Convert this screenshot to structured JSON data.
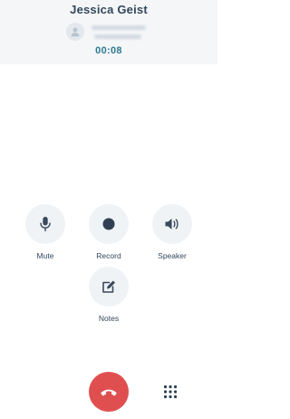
{
  "caller": {
    "name": "Jessica Geist",
    "timer": "00:08"
  },
  "controls": [
    {
      "key": "mute",
      "label": "Mute",
      "icon": "microphone-icon"
    },
    {
      "key": "record",
      "label": "Record",
      "icon": "record-dot-icon"
    },
    {
      "key": "speaker",
      "label": "Speaker",
      "icon": "speaker-icon"
    },
    {
      "key": "notes",
      "label": "Notes",
      "icon": "edit-note-icon"
    }
  ],
  "actions": {
    "end_call_icon": "hang-up-phone-icon",
    "keypad_icon": "keypad-grid-icon"
  },
  "colors": {
    "header_bg": "#f4f6f8",
    "text": "#33475b",
    "timer": "#2f7b8f",
    "control_bg": "#f0f3f6",
    "end_call": "#e04f50"
  }
}
